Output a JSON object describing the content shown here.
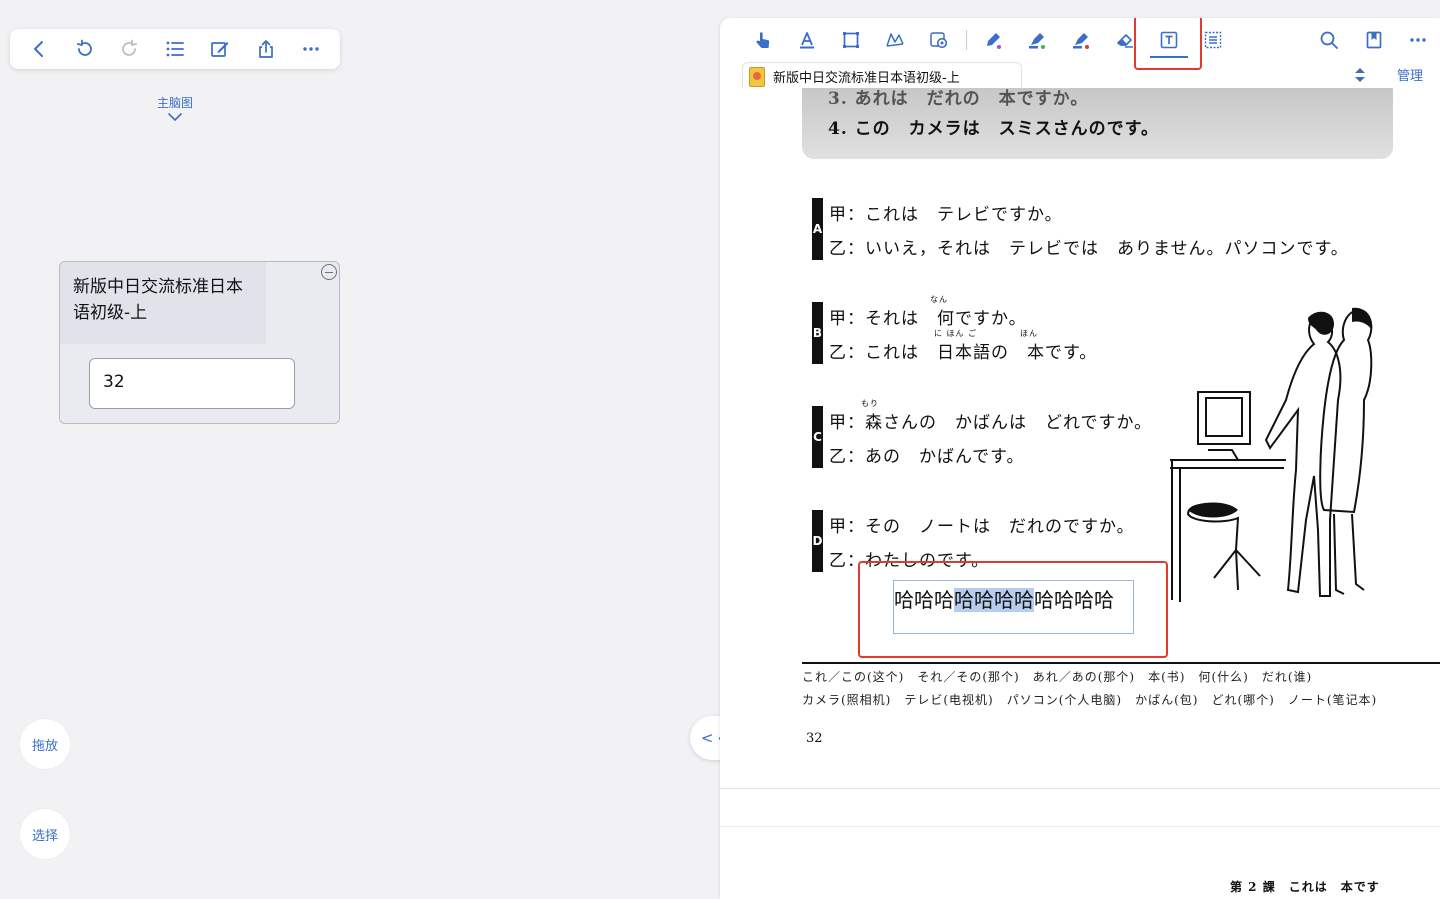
{
  "left_toolbar": {
    "icons": [
      "back-icon",
      "undo-icon",
      "redo-icon",
      "list-icon",
      "edit-icon",
      "share-icon",
      "more-icon"
    ]
  },
  "mindmap_tab": {
    "label": "主脑图"
  },
  "node": {
    "title": "新版中日交流标准日本语初级-上",
    "child_text": "32"
  },
  "fabs": {
    "drag": "拖放",
    "select": "选择"
  },
  "pdf_toolbar": {
    "tools": [
      "hand-tool-icon",
      "text-highlight-icon",
      "rect-select-icon",
      "lasso-icon",
      "settings-icon",
      "pen-icon",
      "highlighter-green-icon",
      "highlighter-red-icon",
      "eraser-icon",
      "textbox-tool-icon",
      "text-select-icon",
      "search-icon",
      "bookmark-icon",
      "more-icon"
    ],
    "active_tool": "textbox-tool-icon",
    "accent_color": "#3a6ec8",
    "highlight_color": "#e23b2e"
  },
  "doc_tab": {
    "title": "新版中日交流标准日本语初级-上",
    "manage": "管理"
  },
  "page": {
    "line3": "3. あれは　だれの　本ですか。",
    "line4": "4. この　カメラは　スミスさんのです。",
    "dialogs": [
      {
        "tag": "A",
        "l1": "甲：これは　テレビですか。",
        "l2": "乙：いいえ，それは　テレビでは　ありません。パソコンです。"
      },
      {
        "tag": "B",
        "l1": "甲：それは　何ですか。",
        "l2": "乙：これは　日本語の　本です。"
      },
      {
        "tag": "C",
        "l1": "甲：森さんの　かばんは　どれですか。",
        "l2": "乙：あの　かばんです。"
      },
      {
        "tag": "D",
        "l1": "甲：その　ノートは　だれのですか。",
        "l2": "乙：わたしのです。"
      }
    ],
    "ruby": {
      "nan": "なん",
      "nihongo": "に ほん ご",
      "hon": "ほん",
      "mori": "もり"
    },
    "annotation": {
      "pre": "哈哈哈",
      "selected": "哈哈哈哈",
      "post": "哈哈哈哈"
    },
    "vocab_row1": "これ／この(这个)　それ／その(那个)　あれ／あの(那个)　本(书)　何(什么)　だれ(谁)",
    "vocab_row2": "カメラ(照相机)　テレビ(电视机)　パソコン(个人电脑)　かばん(包)　どれ(哪个)　ノート(笔记本)",
    "page_number": "32",
    "footer": "第 2 課　これは　本です"
  }
}
